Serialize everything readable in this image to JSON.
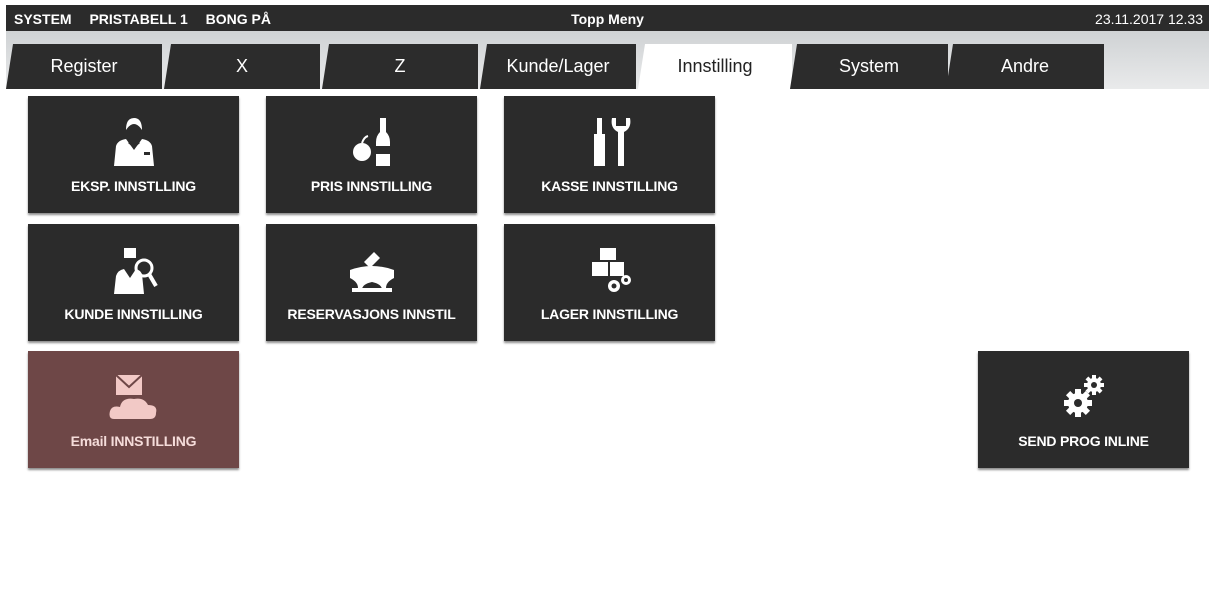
{
  "status_bar": {
    "items": [
      "SYSTEM",
      "PRISTABELL 1",
      "BONG PÅ"
    ],
    "title": "Topp Meny",
    "datetime": "23.11.2017 12.33"
  },
  "tabs": [
    {
      "label": "Register",
      "active": false
    },
    {
      "label": "X",
      "active": false
    },
    {
      "label": "Z",
      "active": false
    },
    {
      "label": "Kunde/Lager",
      "active": false
    },
    {
      "label": "Innstilling",
      "active": true
    },
    {
      "label": "System",
      "active": false
    },
    {
      "label": "Andre",
      "active": false
    }
  ],
  "tiles": {
    "eksp": {
      "label": "EKSP. INNSTLLING",
      "icon": "waiter-icon"
    },
    "pris": {
      "label": "PRIS INNSTILLING",
      "icon": "apple-bottle-icon"
    },
    "kasse": {
      "label": "KASSE INNSTILLING",
      "icon": "tools-icon"
    },
    "kunde": {
      "label": "KUNDE INNSTILLING",
      "icon": "customer-search-icon"
    },
    "reservasjon": {
      "label": "RESERVASJONS INNSTIL",
      "icon": "table-reservation-icon"
    },
    "lager": {
      "label": "LAGER INNSTILLING",
      "icon": "warehouse-gear-icon"
    },
    "email": {
      "label": "Email INNSTILLING",
      "icon": "email-cloud-icon",
      "color": "#6e4747"
    },
    "send": {
      "label": "SEND PROG INLINE",
      "icon": "gears-icon"
    }
  },
  "colors": {
    "tile": "#2b2b2b",
    "statusbar": "#2b2b2b",
    "active_tab": "#ffffff"
  }
}
